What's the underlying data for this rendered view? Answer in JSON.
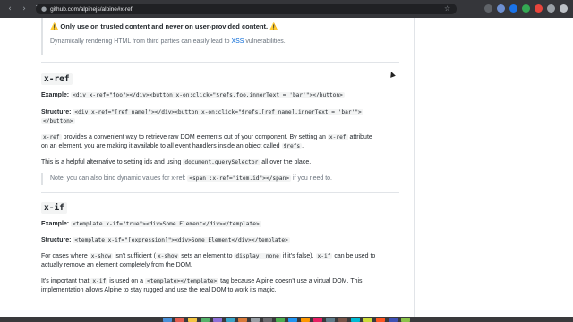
{
  "browser": {
    "back_icon": "‹",
    "forward_icon": "›",
    "reload_icon": "↻",
    "lock_icon": "🔒",
    "url": "github.com/alpinejs/alpine#x-ref",
    "star_icon": "☆",
    "extension_colors": [
      "#5f6368",
      "#6d8fd1",
      "#1a73e8",
      "#34a853",
      "#e8453c",
      "#9aa0a6",
      "#bdc1c6"
    ]
  },
  "warning": {
    "title": "⚠️ Only use on trusted content and never on user-provided content. ⚠️",
    "text_before": "Dynamically rendering HTML from third parties can easily lead to ",
    "link": "XSS",
    "text_after": " vulnerabilities."
  },
  "x_ref": {
    "heading": "x-ref",
    "example_label": "Example:",
    "example_code": "<div x-ref=\"foo\"></div><button x-on:click=\"$refs.foo.innerText = 'bar'\"></button>",
    "structure_label": "Structure:",
    "structure_code_1": "<div x-ref=\"[ref name]\"></div><button x-on:click=\"$refs.[ref name].innerText = 'bar'\">",
    "structure_code_2": "</button>",
    "desc_1_code": "x-ref",
    "desc_1_a": " provides a convenient way to retrieve raw DOM elements out of your component. By setting an ",
    "desc_1_code2": "x-ref",
    "desc_1_b": " attribute",
    "desc_1_line2": "on an element, you are making it available to all event handlers inside an object called ",
    "desc_1_code3": "$refs",
    "desc_1_end": ".",
    "desc_2_a": "This is a helpful alternative to setting ids and using ",
    "desc_2_code": "document.querySelector",
    "desc_2_b": " all over the place.",
    "note_a": "Note: you can also bind dynamic values for x-ref: ",
    "note_code": "<span :x-ref=\"item.id\"></span>",
    "note_b": " if you need to."
  },
  "x_if": {
    "heading": "x-if",
    "example_label": "Example:",
    "example_code": "<template x-if=\"true\"><div>Some Element</div></template>",
    "structure_label": "Structure:",
    "structure_code": "<template x-if=\"[expression]\"><div>Some Element</div></template>",
    "p1_a": "For cases where ",
    "p1_code1": "x-show",
    "p1_b": " isn't sufficient (",
    "p1_code2": "x-show",
    "p1_c": " sets an element to ",
    "p1_code3": "display: none",
    "p1_d": " if it's false), ",
    "p1_code4": "x-if",
    "p1_e": " can be used to",
    "p1_line2": "actually remove an element completely from the DOM.",
    "p2_a": "It's important that ",
    "p2_code1": "x-if",
    "p2_b": " is used on a ",
    "p2_code2": "<template></template>",
    "p2_c": " tag because Alpine doesn't use a virtual DOM. This",
    "p2_line2": "implementation allows Alpine to stay rugged and use the real DOM to work its magic."
  },
  "dock_colors": [
    "#4a90d9",
    "#e35d4f",
    "#f5c542",
    "#55b36b",
    "#8e6fd8",
    "#3aa6c9",
    "#d97a3a",
    "#9aa0a6",
    "#6c6c70",
    "#4caf50",
    "#2196f3",
    "#ff9800",
    "#e91e63",
    "#607d8b",
    "#795548",
    "#00bcd4",
    "#cddc39",
    "#ff5722",
    "#3f51b5",
    "#8bc34a"
  ]
}
